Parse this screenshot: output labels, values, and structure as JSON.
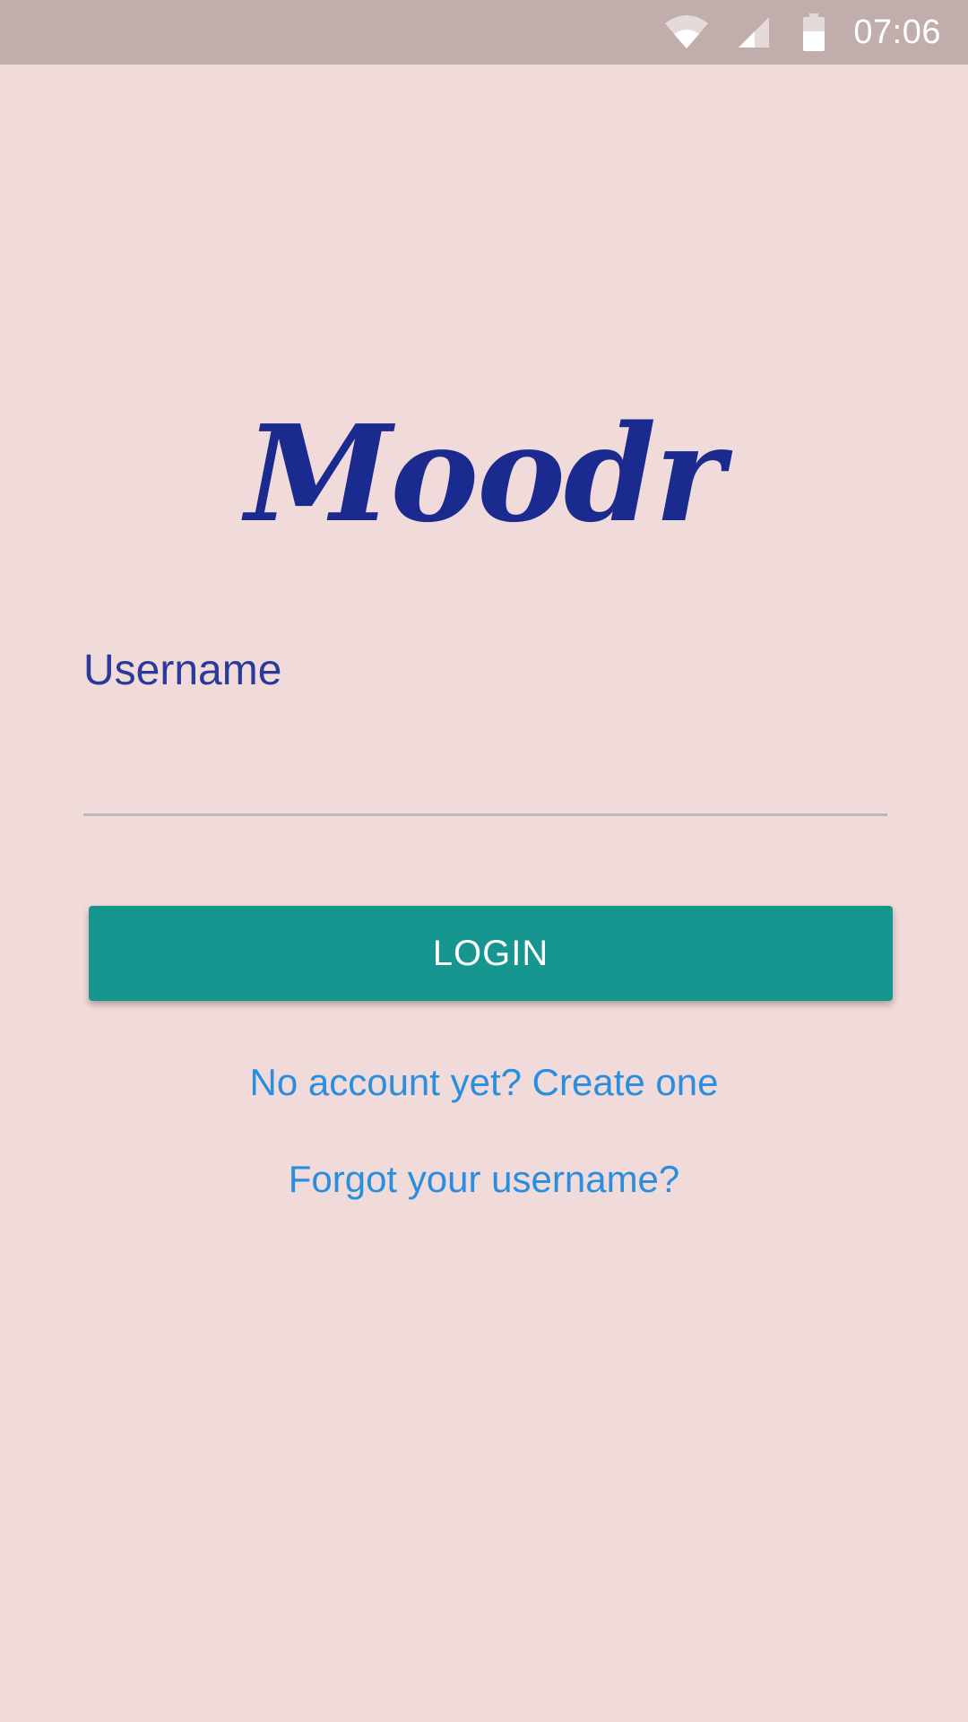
{
  "status_bar": {
    "time": "07:06",
    "icons": [
      "wifi-icon",
      "signal-icon",
      "battery-icon"
    ]
  },
  "app": {
    "title": "Moodr"
  },
  "form": {
    "username_label": "Username",
    "username_value": "",
    "login_label": "LOGIN"
  },
  "links": {
    "create_account": "No account yet? Create one",
    "forgot_username": "Forgot your username?"
  },
  "colors": {
    "background": "#f1dada",
    "status_bar": "#c1adac",
    "logo": "#1b2a8f",
    "label": "#2a3a9a",
    "button": "#17958f",
    "link": "#2a8ee0"
  }
}
